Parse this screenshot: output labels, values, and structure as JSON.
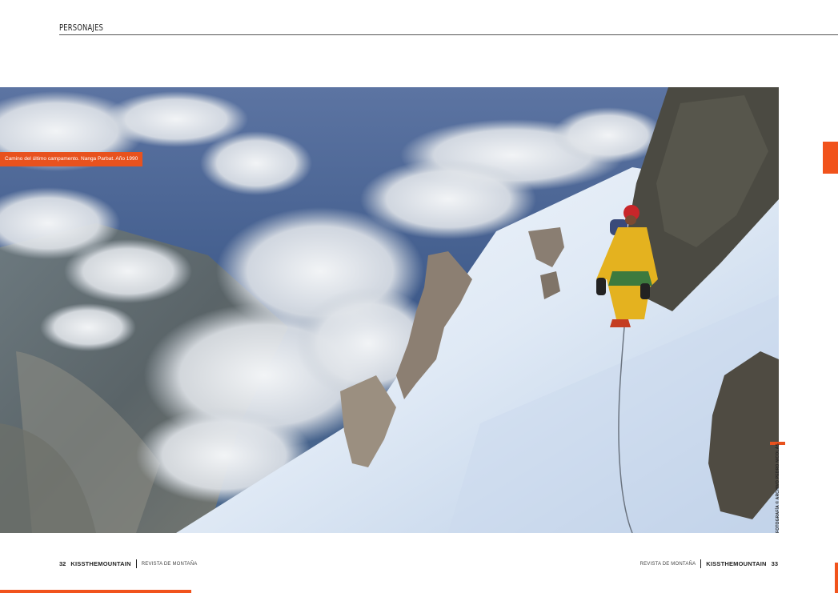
{
  "header": {
    "section": "PERSONAJES"
  },
  "photo": {
    "caption": "Camino del último campamento. Nanga Parbat. Año 1990",
    "credit": "FOTOGRAFÍA © ARCHIVO PEDRO NICOLÁS"
  },
  "footer_left": {
    "page": "32",
    "brand": "KISSTHEMOUNTAIN",
    "magazine": "REVISTA DE MONTAÑA"
  },
  "footer_right": {
    "magazine": "REVISTA DE MONTAÑA",
    "brand": "KISSTHEMOUNTAIN",
    "page": "33"
  },
  "colors": {
    "accent": "#f1531c"
  }
}
